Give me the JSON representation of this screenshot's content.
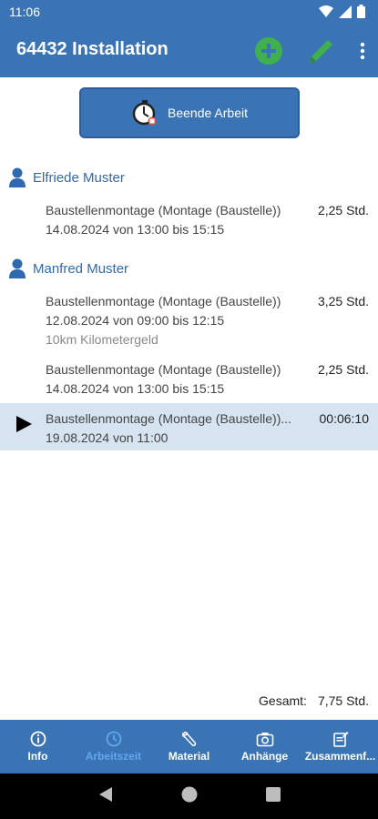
{
  "status_bar": {
    "time": "11:06"
  },
  "app_bar": {
    "title": "64432 Installation",
    "icons": [
      "plus-circle-icon",
      "pencil-icon",
      "more-vert-icon"
    ]
  },
  "primary_button": {
    "label": "Beende Arbeit",
    "icon": "stopwatch-icon"
  },
  "groups": [
    {
      "person": "Elfriede Muster",
      "entries": [
        {
          "title": "Baustellenmontage (Montage (Baustelle))",
          "date": "14.08.2024 von 13:00 bis 15:15",
          "duration": "2,25 Std."
        }
      ]
    },
    {
      "person": "Manfred Muster",
      "entries": [
        {
          "title": "Baustellenmontage (Montage (Baustelle))",
          "date": "12.08.2024 von 09:00 bis 12:15",
          "note": "10km Kilometergeld",
          "duration": "3,25 Std."
        },
        {
          "title": "Baustellenmontage (Montage (Baustelle))",
          "date": "14.08.2024 von 13:00 bis 15:15",
          "duration": "2,25 Std."
        },
        {
          "title": "Baustellenmontage (Montage (Baustelle))...",
          "date": "19.08.2024 von 11:00",
          "duration": "00:06:10",
          "running": true
        }
      ]
    }
  ],
  "total": {
    "label": "Gesamt:",
    "value": "7,75 Std."
  },
  "bottom_nav": [
    {
      "label": "Info",
      "icon": "info-icon"
    },
    {
      "label": "Arbeitszeit",
      "icon": "clock-icon",
      "active": true
    },
    {
      "label": "Material",
      "icon": "wrench-icon"
    },
    {
      "label": "Anhänge",
      "icon": "camera-icon"
    },
    {
      "label": "Zusammenf...",
      "icon": "summary-icon"
    }
  ],
  "colors": {
    "primary": "#3a74b5",
    "accent_green": "#3fb04d",
    "active_row": "#d6e3f1",
    "nav_active": "#61a7ee"
  }
}
